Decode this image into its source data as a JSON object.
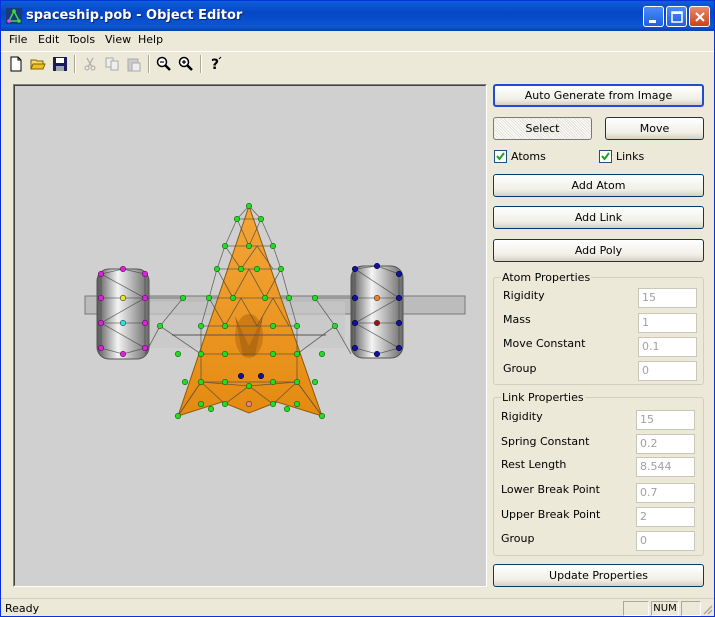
{
  "window": {
    "title": "spaceship.pob - Object Editor"
  },
  "menu": {
    "file": "File",
    "edit": "Edit",
    "tools": "Tools",
    "view": "View",
    "help": "Help"
  },
  "toolbar": {
    "icons": [
      "new-file-icon",
      "open-folder-icon",
      "save-icon",
      "cut-icon",
      "copy-icon",
      "paste-icon",
      "zoom-out-icon",
      "zoom-in-icon",
      "help-icon"
    ]
  },
  "panel": {
    "auto_generate": "Auto Generate from Image",
    "select": "Select",
    "move": "Move",
    "atoms_label": "Atoms",
    "atoms_checked": true,
    "links_label": "Links",
    "links_checked": true,
    "add_atom": "Add Atom",
    "add_link": "Add Link",
    "add_poly": "Add Poly",
    "update": "Update Properties"
  },
  "atom_properties": {
    "title": "Atom Properties",
    "rigidity_label": "Rigidity",
    "rigidity_value": "15",
    "mass_label": "Mass",
    "mass_value": "1",
    "move_constant_label": "Move Constant",
    "move_constant_value": "0.1",
    "group_label": "Group",
    "group_value": "0"
  },
  "link_properties": {
    "title": "Link Properties",
    "rigidity_label": "Rigidity",
    "rigidity_value": "15",
    "spring_constant_label": "Spring Constant",
    "spring_constant_value": "0.2",
    "rest_length_label": "Rest Length",
    "rest_length_value": "8.544",
    "lower_break_label": "Lower Break Point",
    "lower_break_value": "0.7",
    "upper_break_label": "Upper Break Point",
    "upper_break_value": "2",
    "group_label": "Group",
    "group_value": "0"
  },
  "status": {
    "text": "Ready",
    "num": "NUM"
  },
  "colors": {
    "titlebar": "#0a57d6",
    "canvas_bg": "#d0d0d0",
    "ship_orange": "#f0a020",
    "atom_green": "#22dd22",
    "atom_magenta": "#dd22dd",
    "atom_blue": "#1010b0"
  }
}
